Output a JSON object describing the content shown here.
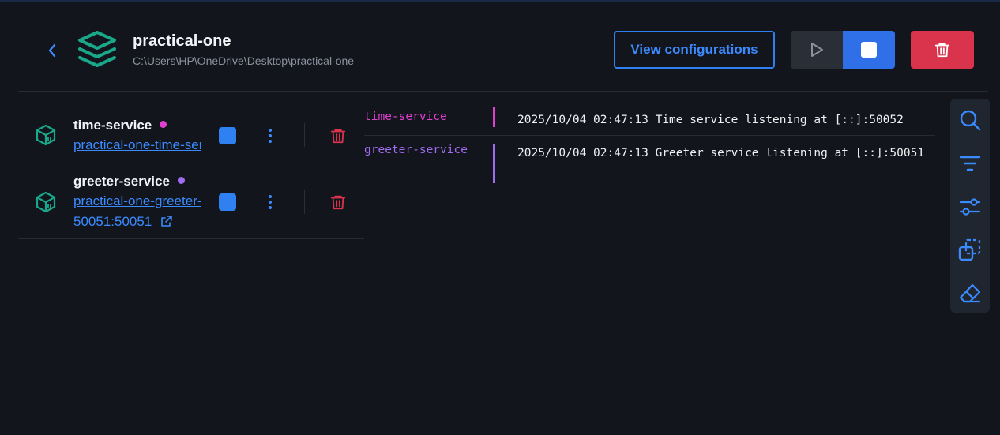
{
  "header": {
    "title": "practical-one",
    "path": "C:\\Users\\HP\\OneDrive\\Desktop\\practical-one",
    "view_config_label": "View configurations"
  },
  "services": [
    {
      "name": "time-service",
      "dot_color": "#e040d0",
      "link": "practical-one-time-service"
    },
    {
      "name": "greeter-service",
      "dot_color": "#a06cf0",
      "link": "practical-one-greeter-service",
      "port": "50051:50051"
    }
  ],
  "logs": [
    {
      "source": "time-service",
      "color": "#e040d0",
      "message": "2025/10/04 02:47:13 Time service listening at [::]:50052"
    },
    {
      "source": "greeter-service",
      "color": "#a06cf0",
      "message": "2025/10/04 02:47:13 Greeter service listening at [::]:50051"
    }
  ],
  "toolbar": {
    "icons": [
      "search-icon",
      "filter-icon",
      "adjust-icon",
      "copy-icon",
      "eraser-icon"
    ]
  },
  "colors": {
    "accent": "#2f7ff0",
    "danger": "#d9344b",
    "teal": "#1aa88a",
    "background": "#12151c"
  }
}
